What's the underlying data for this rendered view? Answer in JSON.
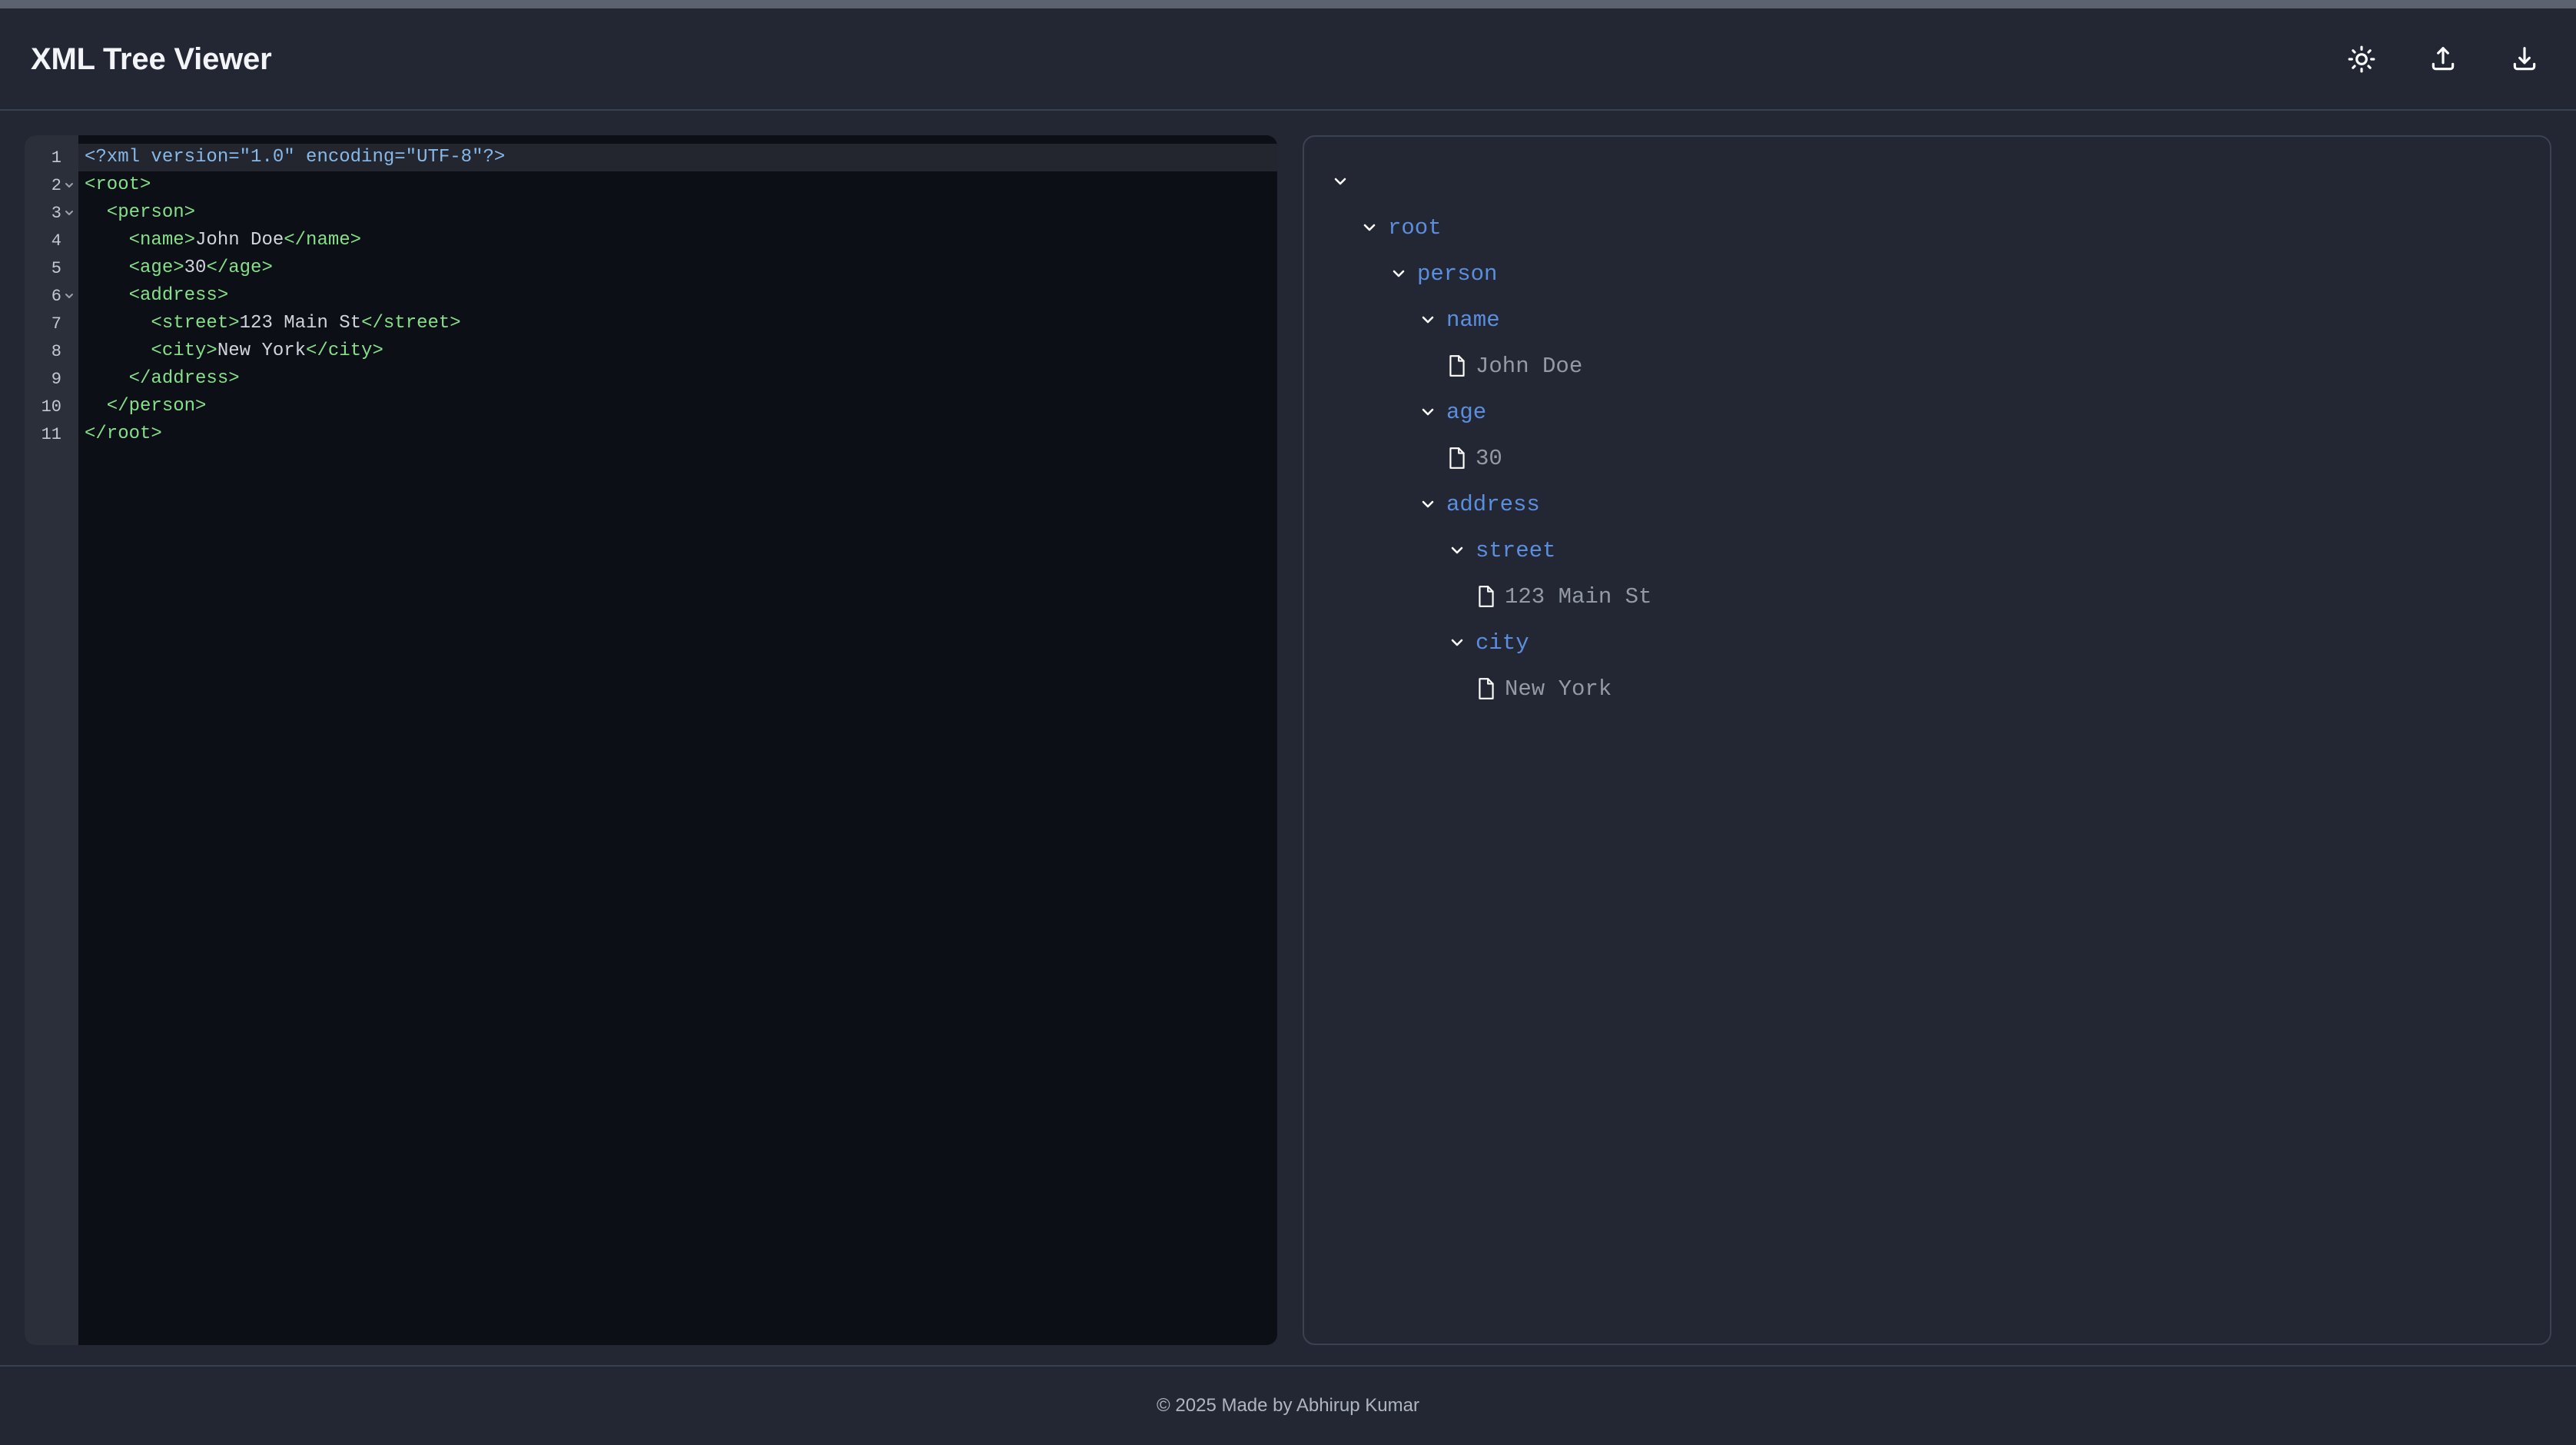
{
  "header": {
    "title": "XML Tree Viewer",
    "actions": [
      {
        "name": "theme-toggle-button",
        "icon": "sun-icon",
        "label": "Toggle theme"
      },
      {
        "name": "upload-button",
        "icon": "upload-icon",
        "label": "Upload XML"
      },
      {
        "name": "download-button",
        "icon": "download-icon",
        "label": "Download XML"
      }
    ]
  },
  "editor": {
    "active_line": 1,
    "lines": [
      {
        "num": "1",
        "fold": false,
        "tokens": [
          {
            "t": "decl",
            "s": "<?xml version=\"1.0\" encoding=\"UTF-8\"?>"
          }
        ]
      },
      {
        "num": "2",
        "fold": true,
        "tokens": [
          {
            "t": "tag",
            "s": "<root>"
          }
        ]
      },
      {
        "num": "3",
        "fold": true,
        "tokens": [
          {
            "t": "tag",
            "s": "  <person>"
          }
        ]
      },
      {
        "num": "4",
        "fold": false,
        "tokens": [
          {
            "t": "tag",
            "s": "    <name>"
          },
          {
            "t": "text",
            "s": "John Doe"
          },
          {
            "t": "tag",
            "s": "</name>"
          }
        ]
      },
      {
        "num": "5",
        "fold": false,
        "tokens": [
          {
            "t": "tag",
            "s": "    <age>"
          },
          {
            "t": "text",
            "s": "30"
          },
          {
            "t": "tag",
            "s": "</age>"
          }
        ]
      },
      {
        "num": "6",
        "fold": true,
        "tokens": [
          {
            "t": "tag",
            "s": "    <address>"
          }
        ]
      },
      {
        "num": "7",
        "fold": false,
        "tokens": [
          {
            "t": "tag",
            "s": "      <street>"
          },
          {
            "t": "text",
            "s": "123 Main St"
          },
          {
            "t": "tag",
            "s": "</street>"
          }
        ]
      },
      {
        "num": "8",
        "fold": false,
        "tokens": [
          {
            "t": "tag",
            "s": "      <city>"
          },
          {
            "t": "text",
            "s": "New York"
          },
          {
            "t": "tag",
            "s": "</city>"
          }
        ]
      },
      {
        "num": "9",
        "fold": false,
        "tokens": [
          {
            "t": "tag",
            "s": "    </address>"
          }
        ]
      },
      {
        "num": "10",
        "fold": false,
        "tokens": [
          {
            "t": "tag",
            "s": "  </person>"
          }
        ]
      },
      {
        "num": "11",
        "fold": false,
        "tokens": [
          {
            "t": "tag",
            "s": "</root>"
          }
        ]
      }
    ]
  },
  "tree": {
    "nodes": [
      {
        "depth": 0,
        "kind": "element",
        "label": "",
        "expanded": true
      },
      {
        "depth": 1,
        "kind": "element",
        "label": "root",
        "expanded": true
      },
      {
        "depth": 2,
        "kind": "element",
        "label": "person",
        "expanded": true
      },
      {
        "depth": 3,
        "kind": "element",
        "label": "name",
        "expanded": true
      },
      {
        "depth": 4,
        "kind": "value",
        "label": "John Doe"
      },
      {
        "depth": 3,
        "kind": "element",
        "label": "age",
        "expanded": true
      },
      {
        "depth": 4,
        "kind": "value",
        "label": "30"
      },
      {
        "depth": 3,
        "kind": "element",
        "label": "address",
        "expanded": true
      },
      {
        "depth": 4,
        "kind": "element",
        "label": "street",
        "expanded": true
      },
      {
        "depth": 5,
        "kind": "value",
        "label": "123 Main St"
      },
      {
        "depth": 4,
        "kind": "element",
        "label": "city",
        "expanded": true
      },
      {
        "depth": 5,
        "kind": "value",
        "label": "New York"
      }
    ]
  },
  "footer": {
    "text": "© 2025 Made by Abhirup Kumar"
  },
  "colors": {
    "background": "#222733",
    "editor_background": "#0c0f16",
    "gutter_background": "#2b2f3a",
    "active_line": "#23252f",
    "tag": "#86e08a",
    "declaration": "#86b9e8",
    "text_content": "#cfd4dd",
    "tree_label": "#5b8ede",
    "tree_value": "#939aa6",
    "border": "#3b4251"
  }
}
